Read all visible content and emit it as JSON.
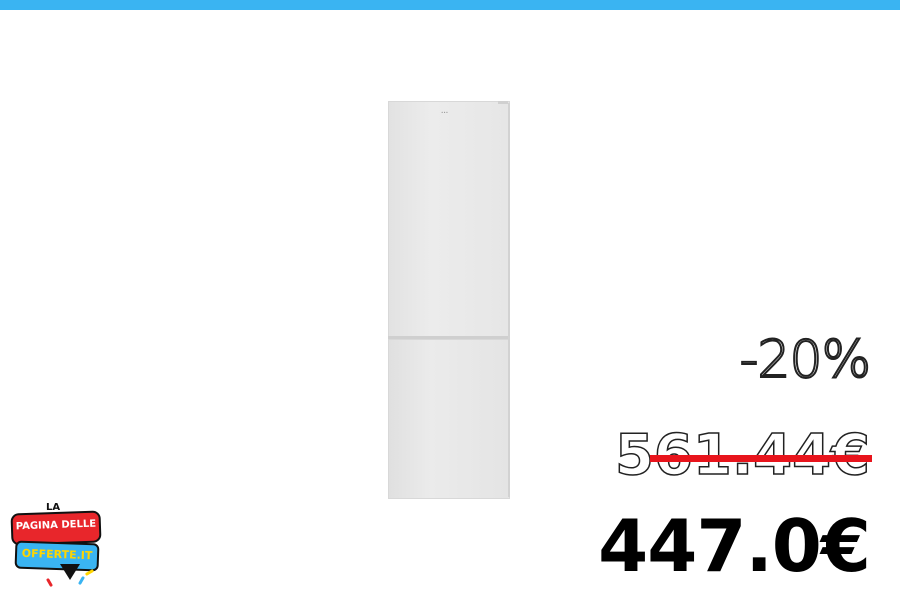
{
  "discount": "-20%",
  "old_price": "561.44€",
  "new_price": "447.0€",
  "logo": {
    "prefix": "LA",
    "line1": "PAGINA DELLE",
    "line2": "OFFERTE.IT"
  },
  "colors": {
    "accent_bar": "#3ab4f2",
    "strike": "#e8141c",
    "logo_red": "#e8262b",
    "logo_blue": "#3ab4f2",
    "logo_yellow": "#ffd500"
  }
}
